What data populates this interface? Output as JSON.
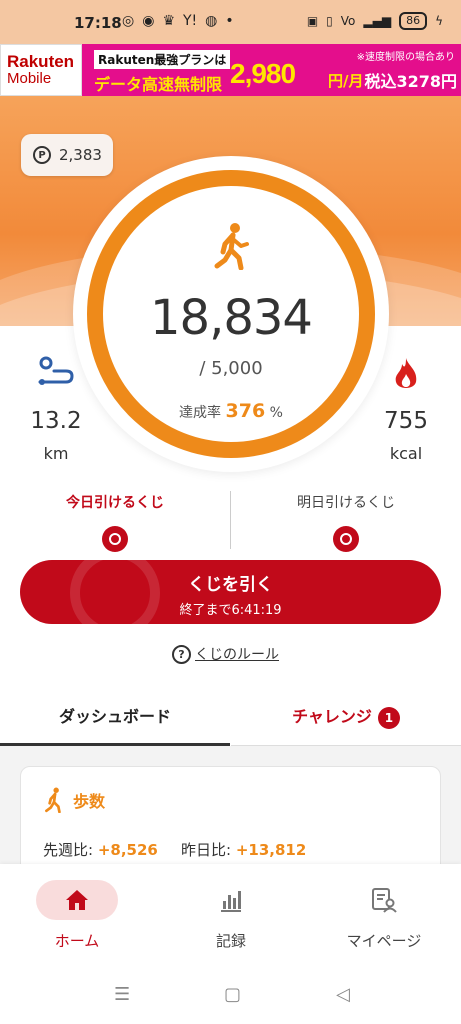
{
  "status_bar": {
    "time": "17:18",
    "battery": "86",
    "icons_left": [
      "app-icon",
      "app-icon",
      "trophy-icon",
      "yahoo-icon",
      "app-icon",
      "dot"
    ],
    "icons_right": [
      "nfc-icon",
      "vibrate-icon",
      "volte-icon",
      "signal-icon",
      "battery-icon",
      "charging-icon"
    ]
  },
  "ad": {
    "logo_line1": "Rakuten",
    "logo_line2": "Mobile",
    "plan": "Rakuten最強プランは",
    "plan_sub": "データ高速無制限",
    "note": "※速度制限の場合あり",
    "price": "2,980",
    "unit": "円/月",
    "tax": "税込3278円"
  },
  "points": {
    "value": "2,383",
    "icon": "P"
  },
  "steps": {
    "value": "18,834",
    "goal": "/ 5,000",
    "rate_label": "達成率",
    "rate_value": "376",
    "rate_unit": "%"
  },
  "distance": {
    "value": "13.2",
    "unit": "km"
  },
  "calories": {
    "value": "755",
    "unit": "kcal"
  },
  "kuji": {
    "today_label": "今日引けるくじ",
    "tomorrow_label": "明日引けるくじ",
    "button_label": "くじを引く",
    "button_sub": "終了まで6:41:19",
    "rule_link": "くじのルール"
  },
  "tabs": {
    "dashboard": "ダッシュボード",
    "challenge": "チャレンジ",
    "challenge_badge": "1"
  },
  "card": {
    "title": "歩数",
    "week_label": "先週比:",
    "week_value": "+8,526",
    "day_label": "昨日比:",
    "day_value": "+13,812"
  },
  "bottom_nav": {
    "home": "ホーム",
    "record": "記録",
    "mypage": "マイページ"
  },
  "colors": {
    "accent_orange": "#ee8a1a",
    "brand_red": "#c10a1a",
    "ad_pink": "#e40e8c"
  }
}
